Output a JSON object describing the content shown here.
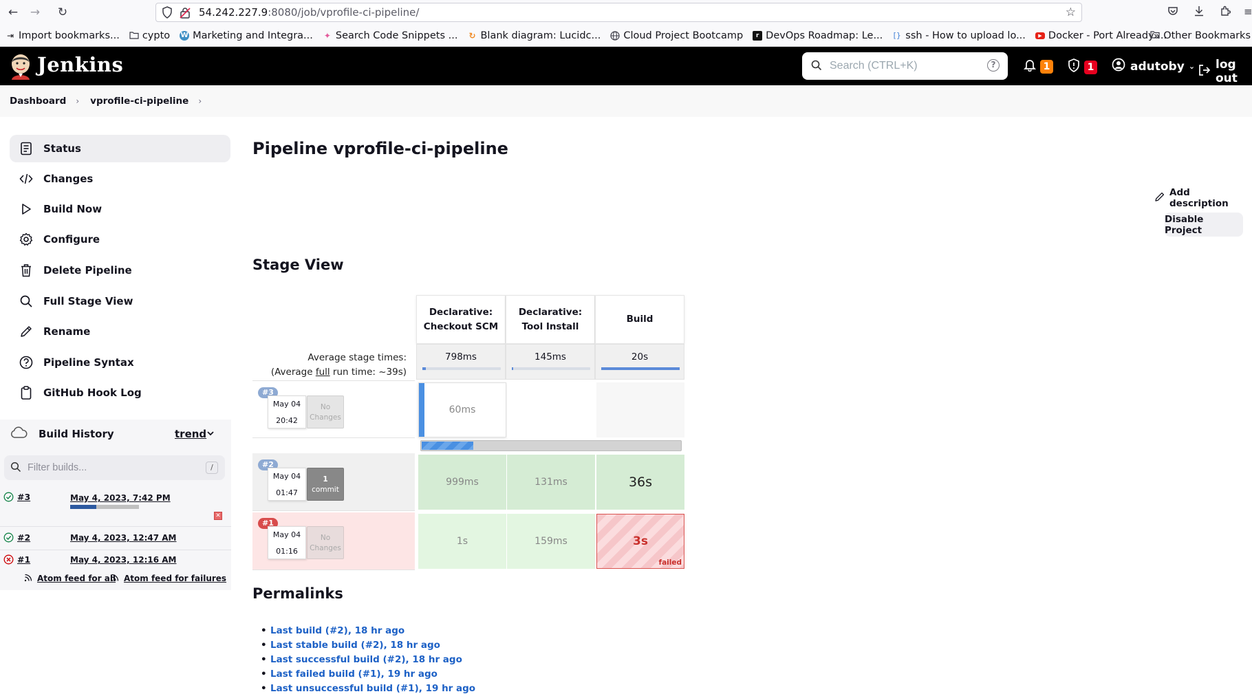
{
  "browser": {
    "url_host": "54.242.227.9",
    "url_path": ":8080/job/vprofile-ci-pipeline/",
    "bookmarks": [
      {
        "label": "Import bookmarks...",
        "icon": "import-icon"
      },
      {
        "label": "cypto",
        "icon": "folder-icon"
      },
      {
        "label": "Marketing and Integra...",
        "icon": "wordpress-icon"
      },
      {
        "label": "Search Code Snippets ...",
        "icon": "snippet-icon"
      },
      {
        "label": "Blank diagram: Lucidc...",
        "icon": "lucid-icon"
      },
      {
        "label": "Cloud Project Bootcamp",
        "icon": "globe-icon"
      },
      {
        "label": "DevOps Roadmap: Le...",
        "icon": "roadmap-icon"
      },
      {
        "label": "ssh - How to upload lo...",
        "icon": "stackoverflow-icon"
      },
      {
        "label": "Docker - Port Already ...",
        "icon": "youtube-icon"
      }
    ],
    "other_bookmarks": "Other Bookmarks"
  },
  "header": {
    "title": "Jenkins",
    "search_placeholder": "Search (CTRL+K)",
    "notifications_count": "1",
    "security_count": "1",
    "user": "adutoby",
    "logout": "log out"
  },
  "breadcrumb": [
    "Dashboard",
    "vprofile-ci-pipeline"
  ],
  "sidebar": {
    "tasks": [
      {
        "label": "Status",
        "icon": "status-icon"
      },
      {
        "label": "Changes",
        "icon": "code-icon"
      },
      {
        "label": "Build Now",
        "icon": "play-icon"
      },
      {
        "label": "Configure",
        "icon": "gear-icon"
      },
      {
        "label": "Delete Pipeline",
        "icon": "trash-icon"
      },
      {
        "label": "Full Stage View",
        "icon": "search-icon"
      },
      {
        "label": "Rename",
        "icon": "pencil-icon"
      },
      {
        "label": "Pipeline Syntax",
        "icon": "help-icon"
      },
      {
        "label": "GitHub Hook Log",
        "icon": "clipboard-icon"
      }
    ]
  },
  "build_history": {
    "title": "Build History",
    "trend": "trend",
    "filter_placeholder": "Filter builds...",
    "filter_shortcut": "/",
    "builds": [
      {
        "number": "#3",
        "date": "May 4, 2023, 7:42 PM",
        "status": "running",
        "progress": 0.38
      },
      {
        "number": "#2",
        "date": "May 4, 2023, 12:47 AM",
        "status": "success"
      },
      {
        "number": "#1",
        "date": "May 4, 2023, 12:16 AM",
        "status": "failed"
      }
    ],
    "feed_all": "Atom feed for all",
    "feed_failures": "Atom feed for failures"
  },
  "main": {
    "title": "Pipeline vprofile-ci-pipeline",
    "add_description": "Add description",
    "disable_project": "Disable Project",
    "stage_view_title": "Stage View"
  },
  "stage_view": {
    "avg_label_1": "Average stage times:",
    "avg_label_2_pre": "(Average ",
    "avg_label_2_full": "full",
    "avg_label_2_post": " run time: ~39s)",
    "stages": [
      {
        "name_line1": "Declarative:",
        "name_line2": "Checkout SCM",
        "avg": "798ms",
        "avg_fraction": 0.04
      },
      {
        "name_line1": "Declarative:",
        "name_line2": "Tool Install",
        "avg": "145ms",
        "avg_fraction": 0.01
      },
      {
        "name_line1": "Build",
        "name_line2": "",
        "avg": "20s",
        "avg_fraction": 1.0
      }
    ],
    "runs": [
      {
        "badge": "#3",
        "date": "May 04",
        "time": "20:42",
        "changes_line1": "No",
        "changes_line2": "Changes",
        "cells": [
          "60ms",
          "",
          ""
        ],
        "status": "running",
        "progress": 0.2
      },
      {
        "badge": "#2",
        "date": "May 04",
        "time": "01:47",
        "changes_line1": "1",
        "changes_line2": "commit",
        "cells": [
          "999ms",
          "131ms",
          "36s"
        ],
        "status": "success"
      },
      {
        "badge": "#1",
        "date": "May 04",
        "time": "01:16",
        "changes_line1": "No",
        "changes_line2": "Changes",
        "cells": [
          "1s",
          "159ms",
          "3s"
        ],
        "status": "failed",
        "failed_label": "failed"
      }
    ]
  },
  "permalinks": {
    "title": "Permalinks",
    "links": [
      "Last build (#2), 18 hr ago",
      "Last stable build (#2), 18 hr ago",
      "Last successful build (#2), 18 hr ago",
      "Last failed build (#1), 19 hr ago",
      "Last unsuccessful build (#1), 19 hr ago"
    ]
  },
  "colors": {
    "accent_blue": "#1d61c6",
    "success_cell": "#d5ecd4",
    "success_cell_light": "#e3f6e1",
    "failed_row": "#fde5e5",
    "failed_cell": "#f6c6c9",
    "badge_orange": "#fe820a",
    "badge_red": "#e6001f"
  }
}
